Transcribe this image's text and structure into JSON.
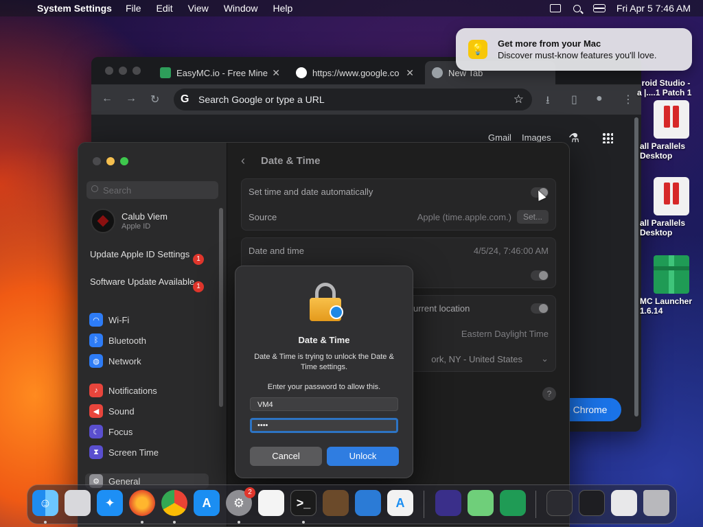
{
  "menubar": {
    "app_name": "System Settings",
    "items": [
      "File",
      "Edit",
      "View",
      "Window",
      "Help"
    ],
    "datetime": "Fri Apr 5  7:46 AM"
  },
  "chrome": {
    "tabs": [
      {
        "title": "EasyMC.io - Free Mine"
      },
      {
        "title": "https://www.google.co"
      },
      {
        "title": "New Tab"
      }
    ],
    "omnibox_placeholder": "Search Google or type a URL",
    "links": {
      "gmail": "Gmail",
      "images": "Images"
    },
    "cta_label": "e Chrome"
  },
  "notification": {
    "title": "Get more from your Mac",
    "body": "Discover must-know features you'll love."
  },
  "desktop": {
    "items": [
      {
        "label": "roid Studio -\na |....1 Patch 1"
      },
      {
        "label": "all Parallels\nDesktop"
      },
      {
        "label": "all Parallels\nDesktop"
      },
      {
        "label": "MC Launcher\n1.6.14"
      }
    ]
  },
  "settings": {
    "search_placeholder": "Search",
    "user": {
      "name": "Calub Viem",
      "subtitle": "Apple ID"
    },
    "alerts": [
      {
        "label": "Update Apple ID Settings",
        "count": "1"
      },
      {
        "label": "Software Update Available",
        "count": "1"
      }
    ],
    "sidebar_items": [
      {
        "label": "Wi-Fi",
        "icon": "wifi-icon",
        "color": "#2e7cf6"
      },
      {
        "label": "Bluetooth",
        "icon": "bluetooth-icon",
        "color": "#2e7cf6"
      },
      {
        "label": "Network",
        "icon": "globe-icon",
        "color": "#2e7cf6"
      },
      {
        "label": "Notifications",
        "icon": "bell-icon",
        "color": "#e8453c"
      },
      {
        "label": "Sound",
        "icon": "speaker-icon",
        "color": "#e8453c"
      },
      {
        "label": "Focus",
        "icon": "moon-icon",
        "color": "#5a4fcf"
      },
      {
        "label": "Screen Time",
        "icon": "hourglass-icon",
        "color": "#5a4fcf"
      },
      {
        "label": "General",
        "icon": "gear-icon",
        "color": "#8e8e93"
      }
    ],
    "page_title": "Date & Time",
    "rows": {
      "auto_time": "Set time and date automatically",
      "source_label": "Source",
      "source_value": "Apple (time.apple.com.)",
      "set_button": "Set...",
      "date_time_label": "Date and time",
      "date_time_value": "4/5/24, 7:46:00 AM",
      "location_label": "urrent location",
      "time_zone_value": "Eastern Daylight Time",
      "closest_city": "ork, NY - United States"
    },
    "help": "?"
  },
  "dialog": {
    "title": "Date & Time",
    "message": "Date & Time is trying to unlock the Date & Time settings.",
    "prompt": "Enter your password to allow this.",
    "username": "VM4",
    "password_mask": "••••",
    "cancel": "Cancel",
    "unlock": "Unlock"
  },
  "dock": {
    "system_settings_badge": "2"
  }
}
